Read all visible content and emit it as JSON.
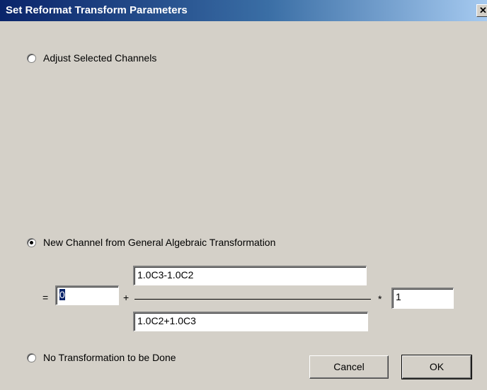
{
  "window": {
    "title": "Set Reformat Transform Parameters",
    "close_glyph": "✕"
  },
  "options": {
    "adjust": {
      "label": "Adjust Selected Channels",
      "selected": false
    },
    "new_channel": {
      "label": "New Channel from General Algebraic Transformation",
      "selected": true
    },
    "none": {
      "label": "No Transformation to be Done",
      "selected": false
    }
  },
  "formula": {
    "equals": "=",
    "offset_value": "0",
    "plus": "+",
    "numerator_value": "1.0C3-1.0C2",
    "denominator_value": "1.0C2+1.0C3",
    "times": "*",
    "multiplier_value": "1"
  },
  "buttons": {
    "cancel": "Cancel",
    "ok": "OK"
  }
}
